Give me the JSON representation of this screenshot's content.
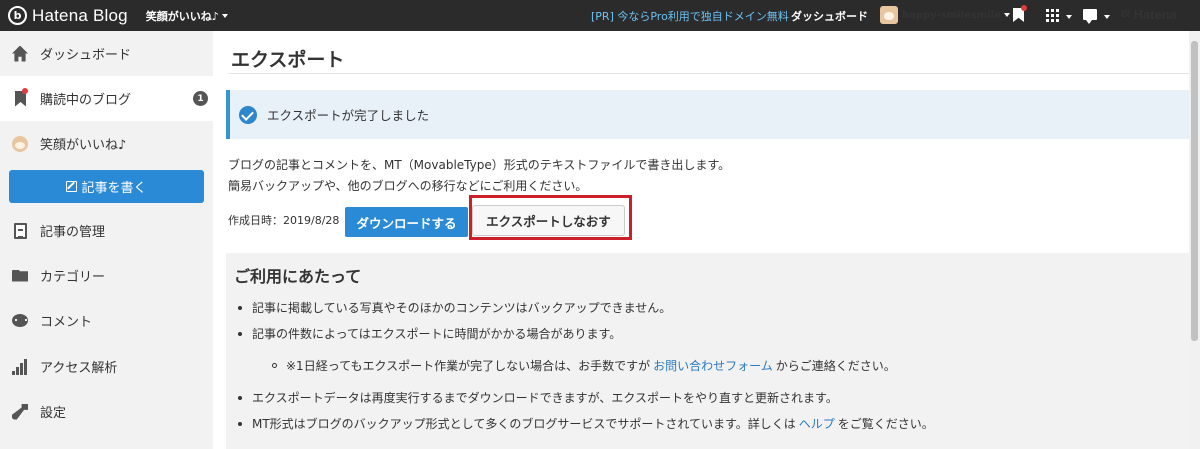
{
  "topbar": {
    "brand_logo": "b",
    "brand_name": "Hatena Blog",
    "blog_name": "笑顔がいいね♪",
    "promo": "[PR] 今ならPro利用で独自ドメイン無料",
    "dashboard": "ダッシュボード",
    "username": "happy-smilesmile",
    "hatena": "Hatena",
    "hatena_mark": "B!",
    "icons": [
      "bookmark-icon",
      "apps-grid-icon",
      "chat-icon"
    ]
  },
  "sidebar": {
    "items": [
      {
        "label": "ダッシュボード",
        "icon": "home-icon"
      },
      {
        "label": "購読中のブログ",
        "icon": "bookmark-icon",
        "badge": "1"
      },
      {
        "label": "笑顔がいいね♪",
        "icon": "cat-avatar-icon"
      },
      {
        "label": "記事の管理",
        "icon": "document-icon"
      },
      {
        "label": "カテゴリー",
        "icon": "folder-icon"
      },
      {
        "label": "コメント",
        "icon": "comment-icon"
      },
      {
        "label": "アクセス解析",
        "icon": "stats-icon"
      },
      {
        "label": "設定",
        "icon": "wrench-icon"
      }
    ],
    "write_button": "記事を書く"
  },
  "main": {
    "title": "エクスポート",
    "alert": "エクスポートが完了しました",
    "desc_line1": "ブログの記事とコメントを、MT（MovableType）形式のテキストファイルで書き出します。",
    "desc_line2": "簡易バックアップや、他のブログへの移行などにご利用ください。",
    "created": "作成日時：2019/8/28",
    "download_button": "ダウンロードする",
    "redo_button": "エクスポートしなおす",
    "notes_title": "ご利用にあたって",
    "note1": "記事に掲載している写真やそのほかのコンテンツはバックアップできません。",
    "note2": "記事の件数によってはエクスポートに時間がかかる場合があります。",
    "note3_pre": "※1日経ってもエクスポート作業が完了しない場合は、お手数ですが",
    "note3_link": "お問い合わせフォーム",
    "note3_post": "からご連絡ください。",
    "note4": "エクスポートデータは再度実行するまでダウンロードできますが、エクスポートをやり直すと更新されます。",
    "note5_pre": "MT形式はブログのバックアップ形式として多くのブログサービスでサポートされています。詳しくは",
    "note5_link": "ヘルプ",
    "note5_post": "をご覧ください。"
  },
  "colors": {
    "topbar": "#2b2b2b",
    "accent": "#2a8ad6",
    "highlight": "#cc1f29",
    "alert_bg": "#e8f1f8"
  }
}
